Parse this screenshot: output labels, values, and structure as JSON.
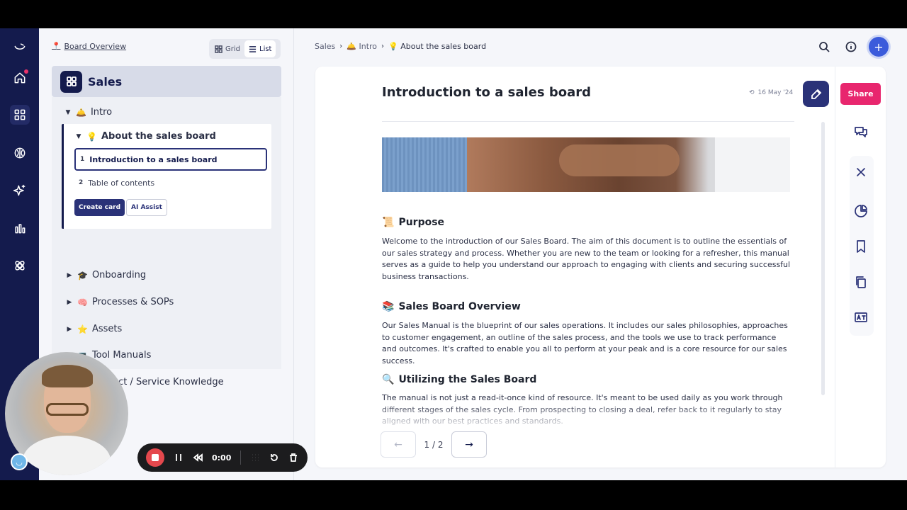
{
  "sidebar": {
    "back_link": "Board Overview",
    "view_grid": "Grid",
    "view_list": "List",
    "board_title": "Sales",
    "intro": {
      "emoji": "🛎️",
      "label": "Intro"
    },
    "about": {
      "emoji": "💡",
      "label": "About the sales board"
    },
    "pages": [
      {
        "num": "1",
        "label": "Introduction to a sales board"
      },
      {
        "num": "2",
        "label": "Table of contents"
      }
    ],
    "create_card": "Create card",
    "ai_assist": "AI Assist",
    "sections": [
      {
        "emoji": "🎓",
        "label": "Onboarding"
      },
      {
        "emoji": "🧠",
        "label": "Processes & SOPs"
      },
      {
        "emoji": "⭐",
        "label": "Assets"
      },
      {
        "emoji": "💻",
        "label": "Tool Manuals"
      },
      {
        "emoji": "🔮",
        "label": "Product / Service Knowledge"
      }
    ]
  },
  "breadcrumb": {
    "items": [
      "Sales",
      "🛎️ Intro",
      "💡 About the sales board"
    ]
  },
  "doc": {
    "title": "Introduction to a sales board",
    "date": "16 May '24",
    "share": "Share",
    "sections": [
      {
        "emoji": "📜",
        "heading": "Purpose",
        "body": "Welcome to the introduction of our Sales Board. The aim of this document is to outline the essentials of our sales strategy and process. Whether you are new to the team or looking for a refresher, this manual serves as a guide to help you understand our approach to engaging with clients and securing successful business transactions."
      },
      {
        "emoji": "📚",
        "heading": "Sales Board Overview",
        "body": "Our Sales Manual is the blueprint of our sales operations. It includes our sales philosophies, approaches to customer engagement, an outline of the sales process, and the tools we use to track performance and outcomes. It's crafted to enable you all to perform at your peak and is a core resource for our sales success."
      },
      {
        "emoji": "🔍",
        "heading": "Utilizing the Sales Board",
        "body": "The manual is not just a read-it-once kind of resource. It's meant to be used daily as you work through different stages of the sales cycle. From prospecting to closing a deal, refer back to it regularly to stay aligned with our best practices and standards."
      }
    ],
    "pager": {
      "prev": "←",
      "count": "1 / 2",
      "next": "→"
    }
  },
  "recorder": {
    "time": "0:00"
  },
  "colors": {
    "navy": "#141b4d",
    "accent": "#2a3278",
    "share": "#e8266e",
    "record": "#e5484d"
  }
}
